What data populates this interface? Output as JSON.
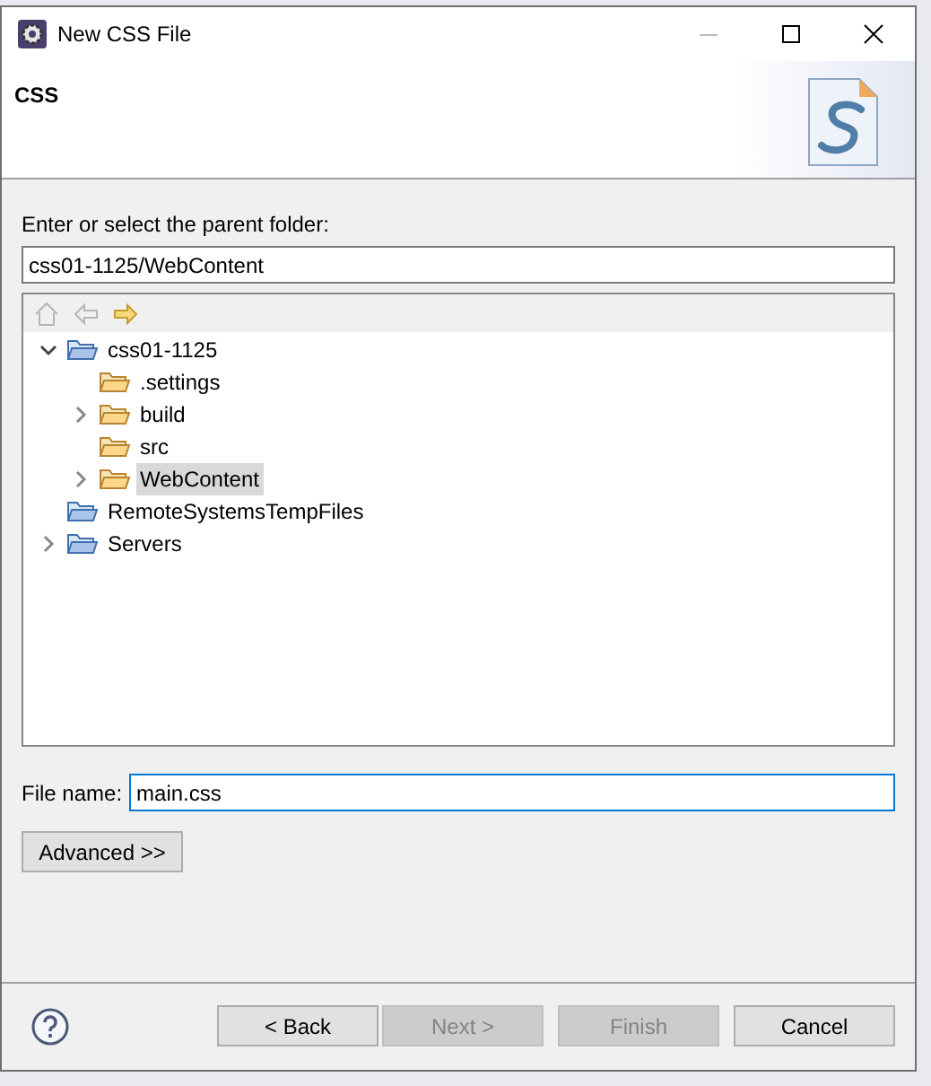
{
  "window": {
    "title": "New CSS File"
  },
  "header": {
    "title": "CSS"
  },
  "parent_folder": {
    "label": "Enter or select the parent folder:",
    "value": "css01-1125/WebContent"
  },
  "tree_nav": [
    {
      "kind": "home",
      "disabled": true
    },
    {
      "kind": "back",
      "disabled": true
    },
    {
      "kind": "forward",
      "disabled": false
    }
  ],
  "tree": [
    {
      "label": "css01-1125",
      "kind": "project",
      "expanded": true,
      "selected": false,
      "children": [
        {
          "label": ".settings",
          "kind": "folder",
          "selected": false
        },
        {
          "label": "build",
          "kind": "folder",
          "expanded": false,
          "selected": false
        },
        {
          "label": "src",
          "kind": "folder",
          "selected": false
        },
        {
          "label": "WebContent",
          "kind": "folder",
          "expanded": false,
          "selected": true
        }
      ]
    },
    {
      "label": "RemoteSystemsTempFiles",
      "kind": "project",
      "selected": false
    },
    {
      "label": "Servers",
      "kind": "project",
      "expanded": false,
      "selected": false
    }
  ],
  "file_name": {
    "label": "File name:",
    "value": "main.css"
  },
  "advanced_button": "Advanced >>",
  "buttons": [
    {
      "label": "< Back",
      "disabled": false
    },
    {
      "label": "Next >",
      "disabled": true
    },
    {
      "label": "Finish",
      "disabled": true
    },
    {
      "label": "Cancel",
      "disabled": false
    }
  ]
}
